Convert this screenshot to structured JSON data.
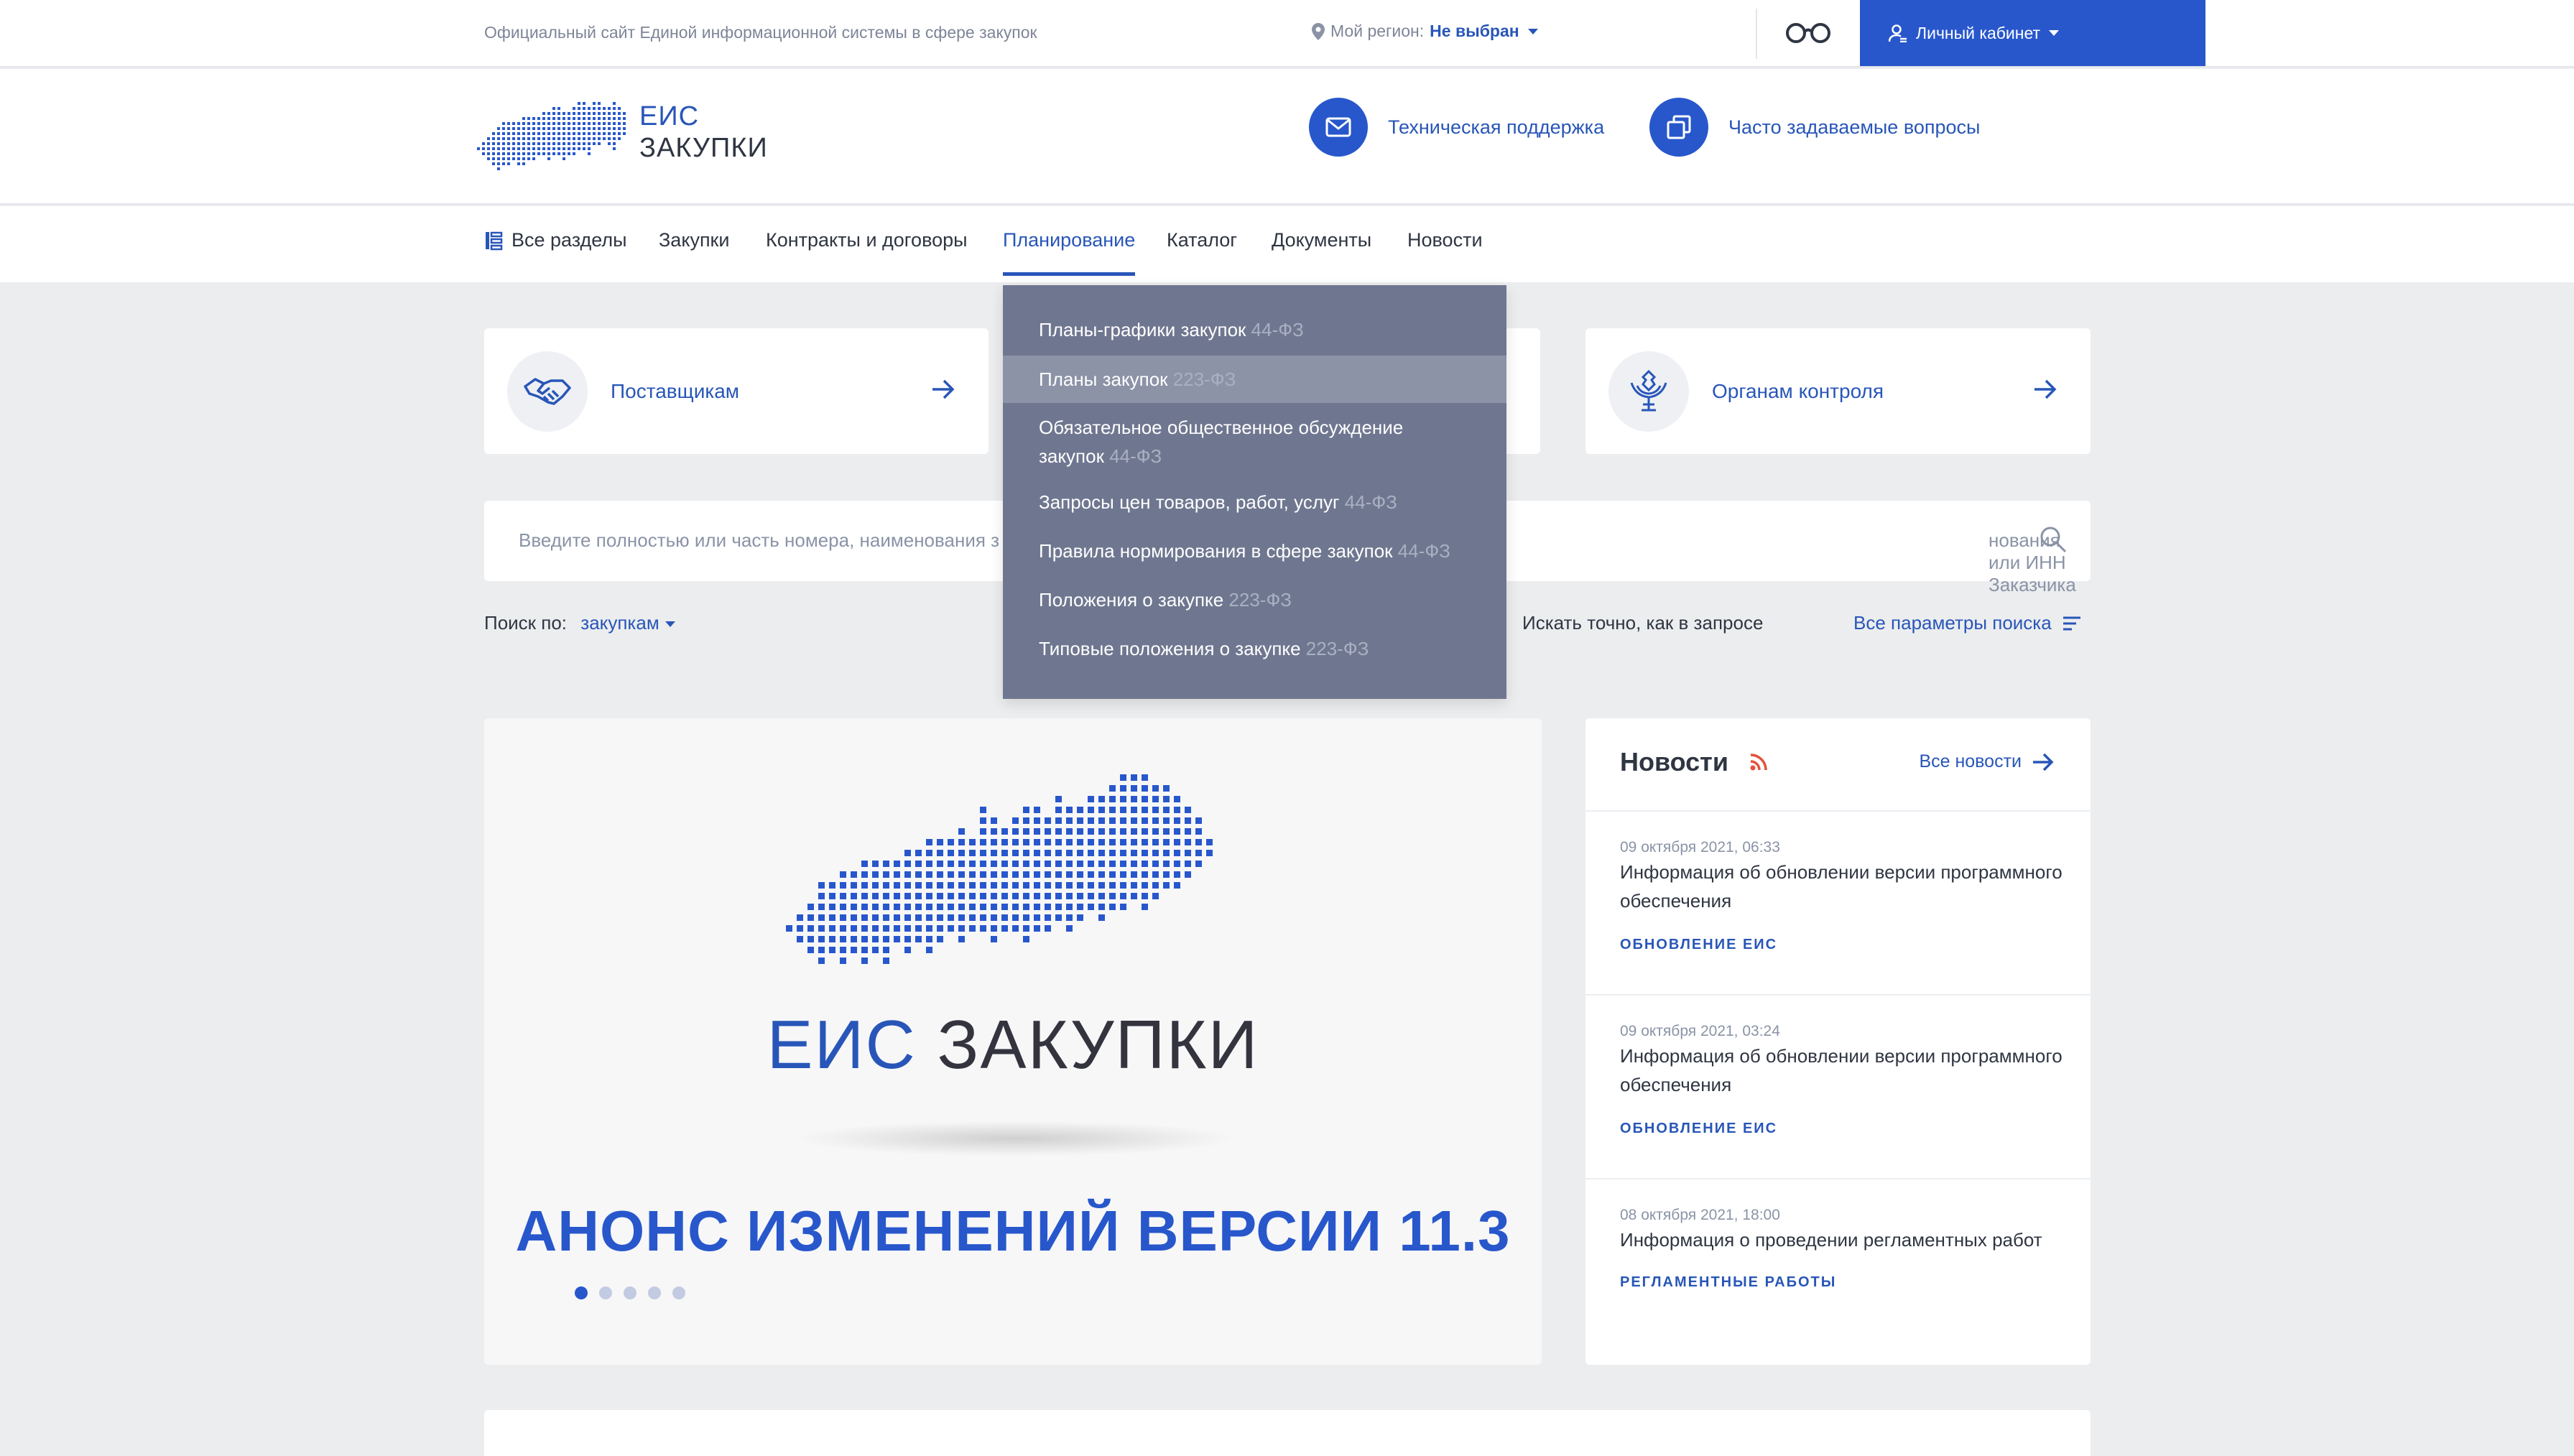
{
  "topbar": {
    "site_text": "Официальный сайт Единой информационной системы в сфере закупок",
    "region_label": "Мой регион:",
    "region_value": "Не выбран",
    "cabinet_label": "Личный кабинет"
  },
  "header": {
    "logo_line1": "ЕИС",
    "logo_line2": "ЗАКУПКИ",
    "support_label": "Техническая поддержка",
    "faq_label": "Часто задаваемые вопросы"
  },
  "nav": {
    "all_sections": "Все разделы",
    "items": [
      "Закупки",
      "Контракты и договоры",
      "Планирование",
      "Каталог",
      "Документы",
      "Новости"
    ],
    "active": "Планирование"
  },
  "planning_menu": {
    "items": [
      {
        "label": "Планы-графики закупок",
        "law": "44-ФЗ"
      },
      {
        "label": "Планы закупок",
        "law": "223-ФЗ"
      },
      {
        "label": "Обязательное общественное обсуждение закупок",
        "law": "44-ФЗ"
      },
      {
        "label": "Запросы цен товаров, работ, услуг",
        "law": "44-ФЗ"
      },
      {
        "label": "Правила нормирования в сфере закупок",
        "law": "44-ФЗ"
      },
      {
        "label": "Положения о закупке",
        "law": "223-ФЗ"
      },
      {
        "label": "Типовые положения о закупке",
        "law": "223-ФЗ"
      }
    ],
    "highlighted_index": 1
  },
  "roles": {
    "suppliers": "Поставщикам",
    "control": "Органам контроля"
  },
  "search": {
    "placeholder_start": "Введите полностью или часть номера, наименования з",
    "placeholder_end": "нования или ИНН Заказчика",
    "by_label": "Поиск по:",
    "by_value": "закупкам",
    "exact_label": "Искать точно, как в запросе",
    "all_params": "Все параметры поиска"
  },
  "banner": {
    "title_part1": "ЕИС",
    "title_part2": "ЗАКУПКИ",
    "subtitle": "АНОНС ИЗМЕНЕНИЙ ВЕРСИИ 11.3",
    "slides_total": 5,
    "active_slide": 1
  },
  "news": {
    "title": "Новости",
    "all_link": "Все новости",
    "items": [
      {
        "date": "09 октября 2021, 06:33",
        "title": "Информация об обновлении версии программного обеспечения",
        "tag": "ОБНОВЛЕНИЕ ЕИС"
      },
      {
        "date": "09 октября 2021, 03:24",
        "title": "Информация об обновлении версии программного обеспечения",
        "tag": "ОБНОВЛЕНИЕ ЕИС"
      },
      {
        "date": "08 октября 2021, 18:00",
        "title": "Информация о проведении регламентных работ",
        "tag": "РЕГЛАМЕНТНЫЕ РАБОТЫ"
      }
    ]
  },
  "colors": {
    "brand_blue": "#2857cc",
    "link_blue": "#2856b8",
    "dropdown_bg": "#6f7790",
    "page_bg": "#ecedef"
  }
}
